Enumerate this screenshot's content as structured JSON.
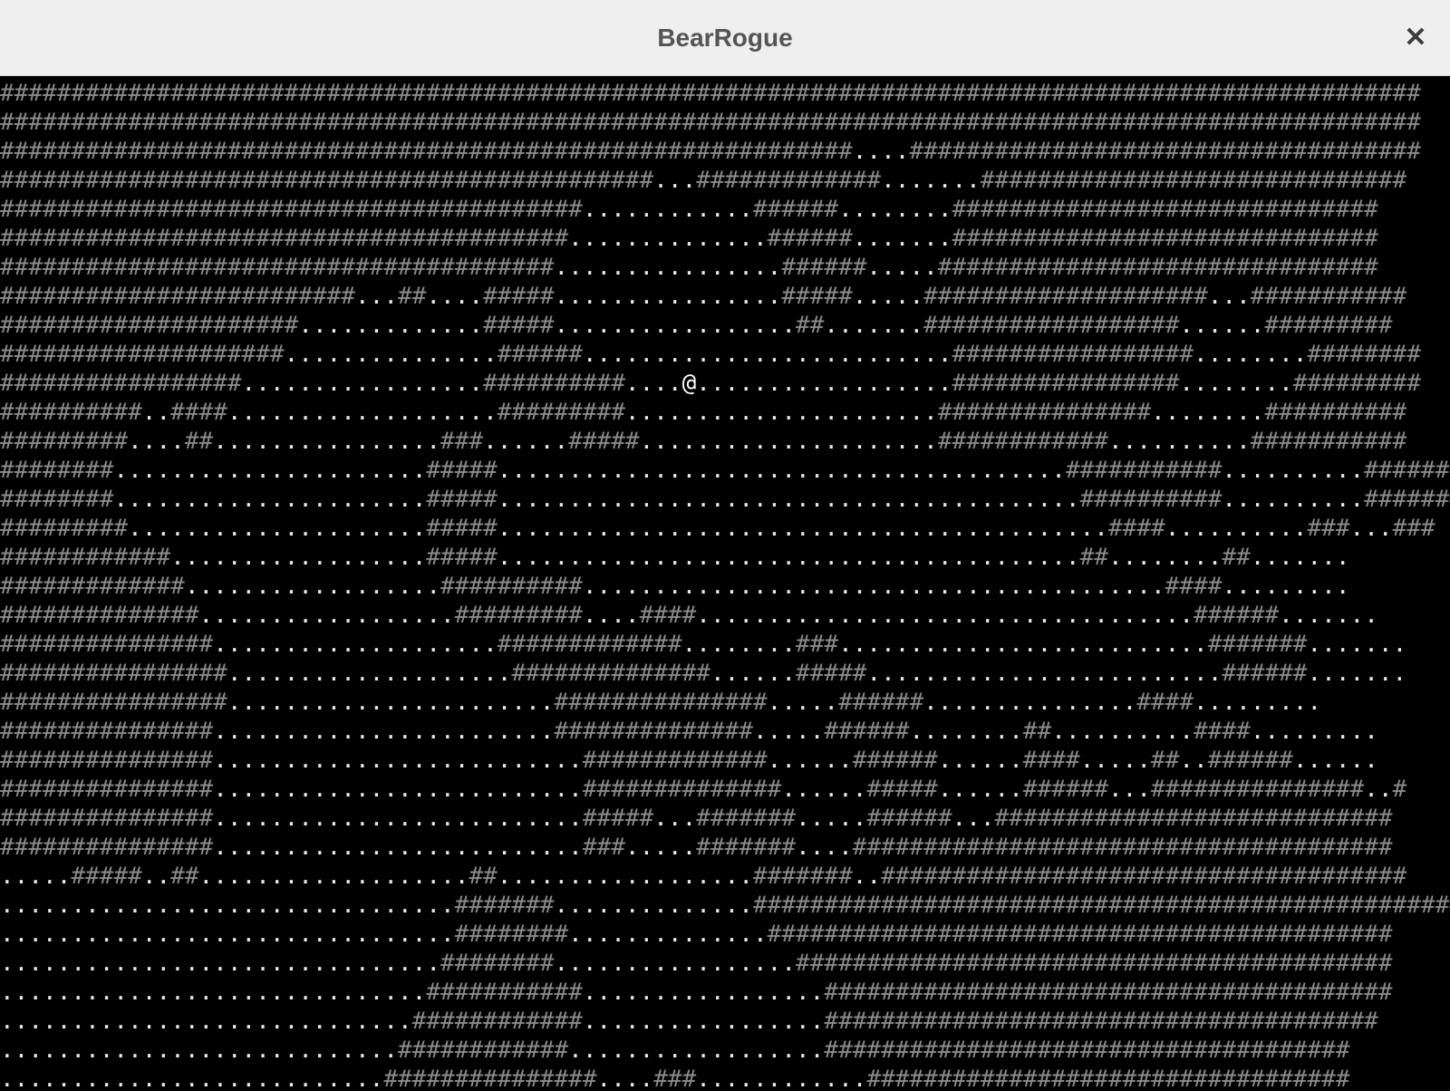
{
  "window": {
    "title": "BearRogue",
    "close_icon": "close-icon"
  },
  "map": {
    "legend": {
      "wall": "#",
      "floor": ".",
      "player": "@"
    },
    "colors": {
      "background": "#000000",
      "wall": "#8a8a8a",
      "floor": "#e8e8e8",
      "player": "#ffffff"
    },
    "rows": [
      "####################################################################################################",
      "####################################################################################################",
      "############################################################....####################################",
      "##############################################...#############.......##############################",
      "#########################################............######........##############################",
      "########################################..............######.......##############################",
      "#######################################................######.....###############################",
      "#########################...##....#####................#####.....####################...###########",
      "#####################.............#####.................##.......##################......#########",
      "####################...............######..........................#################........########",
      "#################.................##########....@..................################........#########",
      "##########..####...................#########......................###############........##########",
      "#########....##................###......#####.....................############..........###########",
      "########......................#####........................................###########..........###########",
      "########......................#####.........................................##########..........#########",
      "#########.....................#####...........................................####..........###...###",
      "############..................#####.........................................##........##.......",
      "#############..................##########.........................................####.........",
      "##############..................#########....####...................................######.......",
      "###############....................#############........###..........................#######.......",
      "################....................##############......#####.........................######.......",
      "################.......................###############.....######...............####.........",
      "###############........................##############.....######........##..........####.........",
      "###############..........................#############......######......####.....##..######......",
      "###############..........................##############......#####......######...###############..#",
      "###############..........................#####...#######.....######...############################",
      "###############..........................###.....#######....######################################",
      ".....#####..##...................##..................#######..#####################################",
      "................................#######..............######################################################",
      "................................########..............############################################",
      "...............................########.................##########################################",
      "..............................###########.................########################################",
      ".............................############.................#######################################",
      "............................############..................#####################################",
      "...........................###############....###............##################################"
    ]
  }
}
